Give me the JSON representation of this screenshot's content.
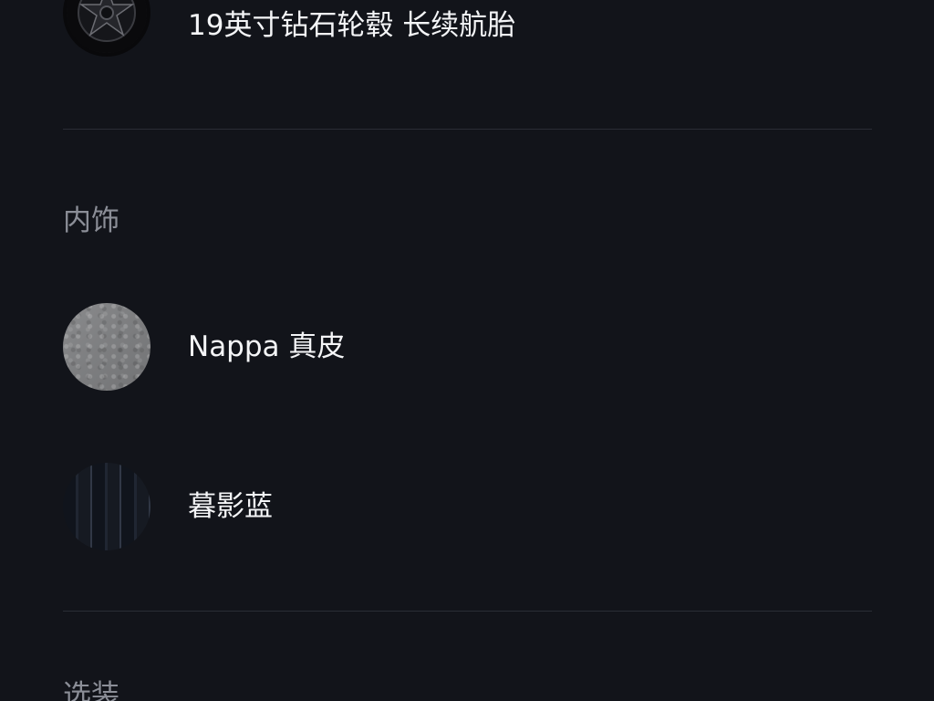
{
  "wheel": {
    "label": "19英寸钻石轮毂 长续航胎",
    "icon": "wheel-icon"
  },
  "interior": {
    "section_title": "内饰",
    "options": [
      {
        "label": "Nappa 真皮",
        "icon": "leather-swatch-icon"
      },
      {
        "label": "暮影蓝",
        "icon": "fabric-swatch-icon"
      }
    ]
  },
  "next_section": {
    "title": "选装"
  },
  "colors": {
    "background": "#12141a",
    "text_primary": "#f4f5f7",
    "text_secondary": "#8b8e97",
    "divider": "#2a2d35"
  }
}
